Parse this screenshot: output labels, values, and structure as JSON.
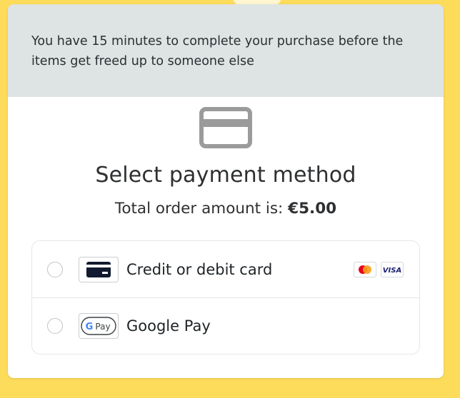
{
  "timer_notice": "You have 15 minutes to complete your purchase before the items get freed up to someone else",
  "header": {
    "title": "Select payment method",
    "total_prefix": "Total order amount is: ",
    "total_amount": "€5.00",
    "icon": "credit-card-icon"
  },
  "payment_methods": [
    {
      "label": "Credit or debit card",
      "icon": "credit-card-icon",
      "selected": false,
      "brands": [
        "Mastercard",
        "VISA"
      ]
    },
    {
      "label": "Google Pay",
      "icon": "google-pay-icon",
      "selected": false,
      "logo_text": "Pay"
    }
  ],
  "colors": {
    "background": "#fedc5b",
    "notice_bg": "#dee3e4",
    "icon_grey": "#9b9b9b",
    "card_icon_dark": "#111a2e",
    "visa_blue": "#1a1f71",
    "mastercard_red": "#eb001b",
    "mastercard_orange": "#f79e1b"
  }
}
